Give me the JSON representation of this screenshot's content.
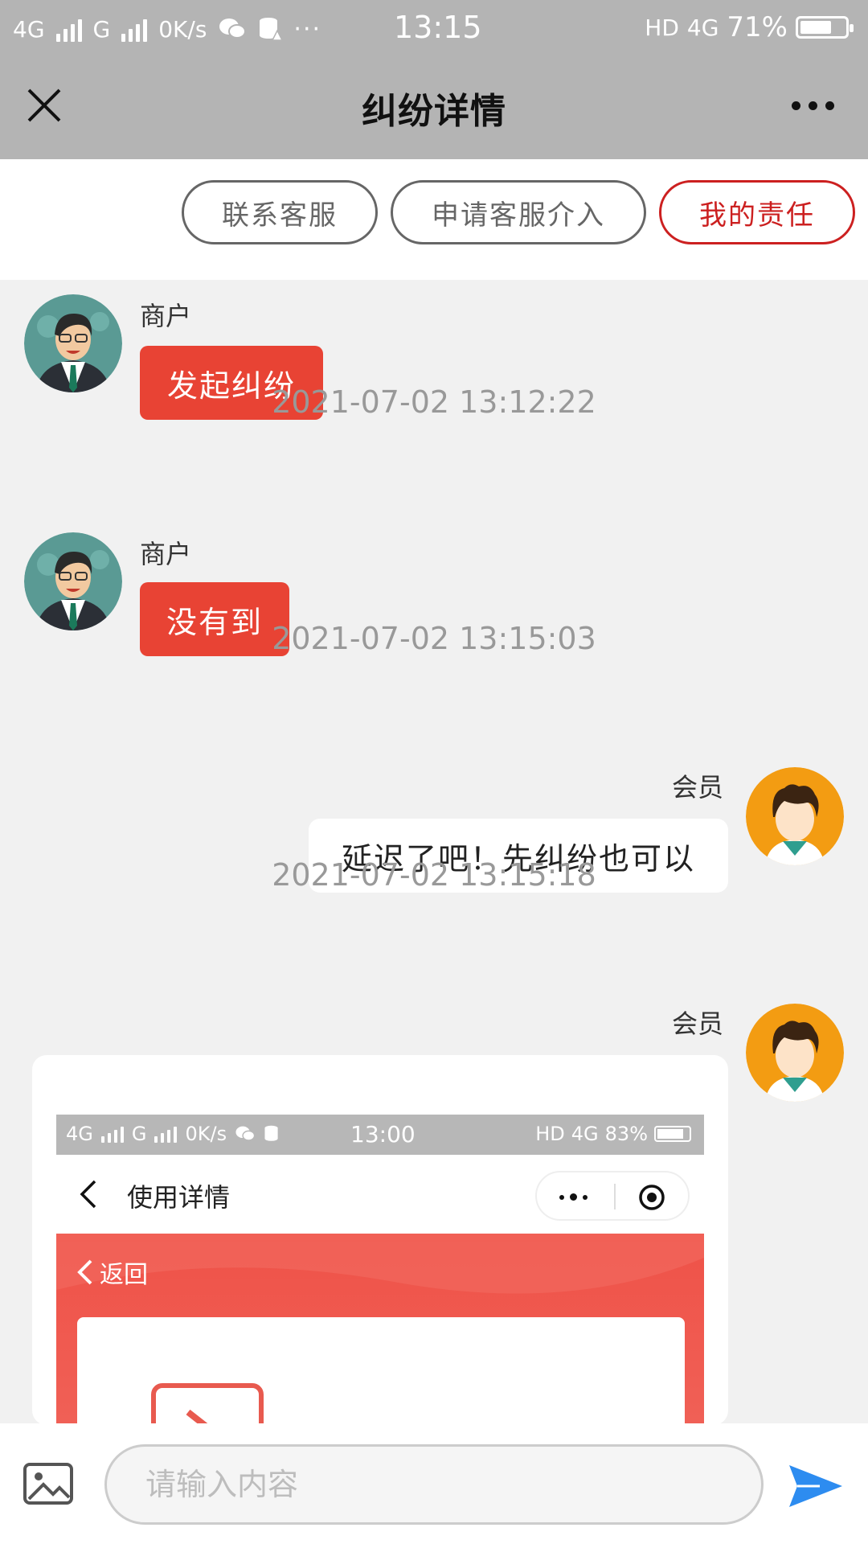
{
  "status_bar": {
    "network1": "4G",
    "network2": "G",
    "speed": "0K/s",
    "time": "13:15",
    "hd": "HD",
    "net_right": "4G",
    "battery": "71%",
    "battery_level": 0.71
  },
  "navbar": {
    "title": "纠纷详情"
  },
  "actions": {
    "contact_service": "联系客服",
    "request_intervention": "申请客服介入",
    "my_responsibility": "我的责任"
  },
  "messages": [
    {
      "sender": "商户",
      "text": "发起纠纷"
    },
    {
      "timestamp": "2021-07-02 13:12:22",
      "sender": "商户",
      "text": "没有到"
    },
    {
      "timestamp": "2021-07-02 13:15:03",
      "sender": "会员",
      "text": "延迟了吧！先纠纷也可以"
    },
    {
      "timestamp": "2021-07-02 13:15:18",
      "sender": "会员"
    }
  ],
  "embedded_screenshot": {
    "status": {
      "network1": "4G",
      "network2": "G",
      "speed": "0K/s",
      "time": "13:00",
      "hd": "HD",
      "net_right": "4G",
      "battery": "83%"
    },
    "title": "使用详情",
    "back_label": "返回"
  },
  "input": {
    "placeholder": "请输入内容"
  },
  "colors": {
    "merchant_bubble": "#e84334",
    "accent_red": "#cc2020",
    "send_icon": "#2d8cf0",
    "header_gray": "#b4b4b4"
  }
}
